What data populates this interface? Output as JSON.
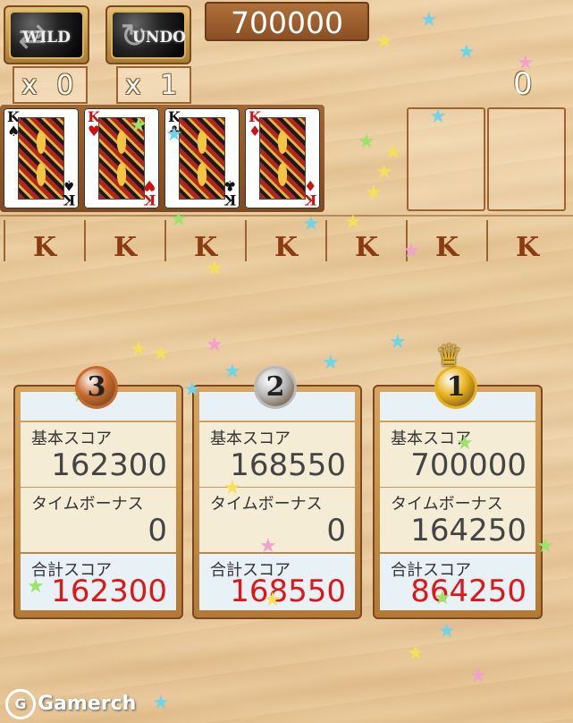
{
  "toolbar": {
    "wild_label": "WILD",
    "undo_label": "UNDO",
    "wild_count": "x 0",
    "undo_count": "x 1",
    "score": "700000",
    "right_counter": "0"
  },
  "cards": [
    {
      "rank": "K",
      "suit": "♠",
      "color": "#111111"
    },
    {
      "rank": "K",
      "suit": "♥",
      "color": "#d01010"
    },
    {
      "rank": "K",
      "suit": "♣",
      "color": "#111111"
    },
    {
      "rank": "K",
      "suit": "♦",
      "color": "#d01010"
    }
  ],
  "rank_labels": [
    "K",
    "K",
    "K",
    "K",
    "K",
    "K",
    "K"
  ],
  "panels": [
    {
      "place": "3",
      "base_label": "基本スコア",
      "base": "162300",
      "bonus_label": "タイムボーナス",
      "bonus": "0",
      "total_label": "合計スコア",
      "total": "162300"
    },
    {
      "place": "2",
      "base_label": "基本スコア",
      "base": "168550",
      "bonus_label": "タイムボーナス",
      "bonus": "0",
      "total_label": "合計スコア",
      "total": "168550"
    },
    {
      "place": "1",
      "base_label": "基本スコア",
      "base": "700000",
      "bonus_label": "タイムボーナス",
      "bonus": "164250",
      "total_label": "合計スコア",
      "total": "864250"
    }
  ],
  "watermark": "Gamerch",
  "colors": {
    "bronze": "#c86a2e",
    "silver": "#b9b9b9",
    "gold": "#e8b21c",
    "total_red": "#e01616"
  }
}
